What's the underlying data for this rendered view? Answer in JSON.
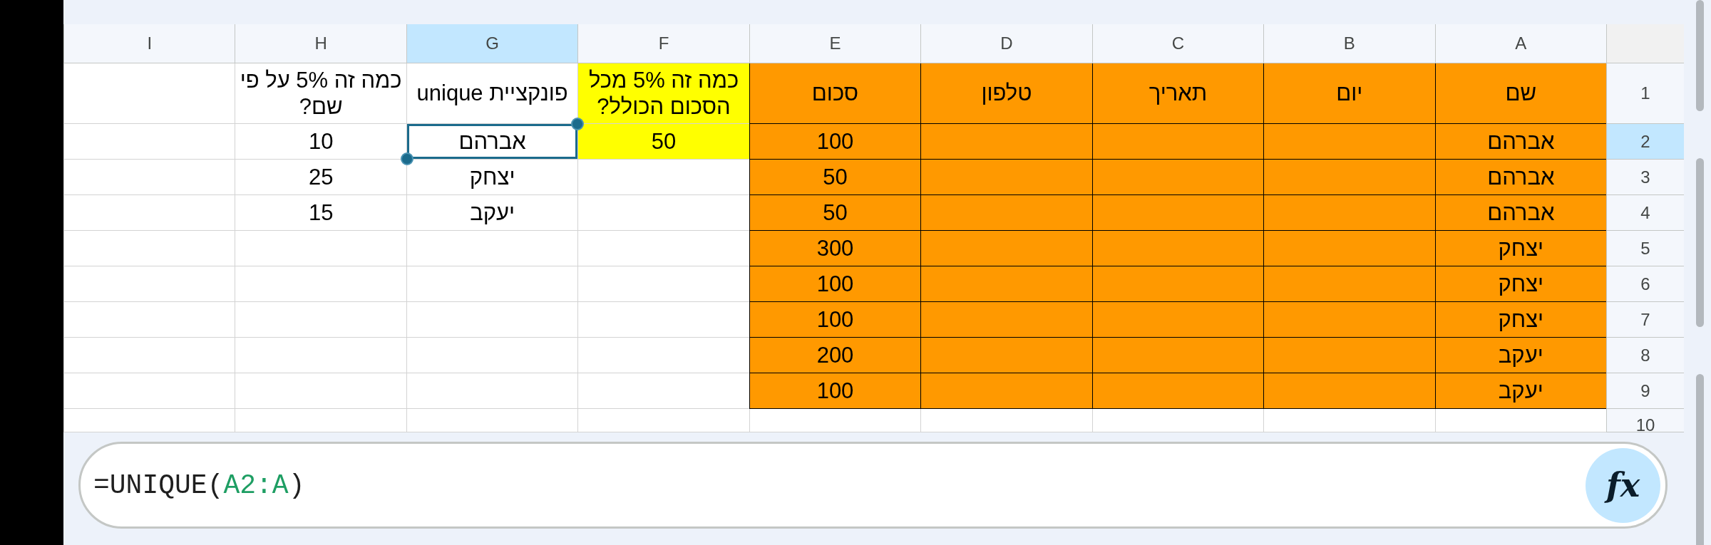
{
  "columns": [
    {
      "label": "A",
      "selected": false
    },
    {
      "label": "B",
      "selected": false
    },
    {
      "label": "C",
      "selected": false
    },
    {
      "label": "D",
      "selected": false
    },
    {
      "label": "E",
      "selected": false
    },
    {
      "label": "F",
      "selected": false
    },
    {
      "label": "G",
      "selected": true
    },
    {
      "label": "H",
      "selected": false
    },
    {
      "label": "I",
      "selected": false
    }
  ],
  "rows": [
    {
      "number": "1",
      "selected": false,
      "cells": [
        {
          "text": "שם",
          "color": "#ff9900",
          "bordered": true,
          "selected": false
        },
        {
          "text": "יום",
          "color": "#ff9900",
          "bordered": true,
          "selected": false
        },
        {
          "text": "תאריך",
          "color": "#ff9900",
          "bordered": true,
          "selected": false
        },
        {
          "text": "טלפון",
          "color": "#ff9900",
          "bordered": true,
          "selected": false
        },
        {
          "text": "סכום",
          "color": "#ff9900",
          "bordered": true,
          "selected": false
        },
        {
          "text": "כמה זה 5% מכל הסכום הכולל?",
          "color": "#ffff00",
          "selected": false
        },
        {
          "text": "פונקציית unique",
          "selected": false
        },
        {
          "text": "כמה זה 5% על פי שם?",
          "selected": false
        },
        {
          "selected": false
        }
      ]
    },
    {
      "number": "2",
      "selected": true,
      "cells": [
        {
          "text": "אברהם",
          "color": "#ff9900",
          "bordered": true,
          "selected": false
        },
        {
          "color": "#ff9900",
          "bordered": true,
          "selected": false
        },
        {
          "color": "#ff9900",
          "bordered": true,
          "selected": false
        },
        {
          "color": "#ff9900",
          "bordered": true,
          "selected": false
        },
        {
          "text": "100",
          "color": "#ff9900",
          "bordered": true,
          "selected": false
        },
        {
          "text": "50",
          "color": "#ffff00",
          "selected": false
        },
        {
          "text": "אברהם",
          "selected": true
        },
        {
          "text": "10",
          "selected": false
        },
        {
          "selected": false
        }
      ]
    },
    {
      "number": "3",
      "selected": false,
      "cells": [
        {
          "text": "אברהם",
          "color": "#ff9900",
          "bordered": true,
          "selected": false
        },
        {
          "color": "#ff9900",
          "bordered": true,
          "selected": false
        },
        {
          "color": "#ff9900",
          "bordered": true,
          "selected": false
        },
        {
          "color": "#ff9900",
          "bordered": true,
          "selected": false
        },
        {
          "text": "50",
          "color": "#ff9900",
          "bordered": true,
          "selected": false
        },
        {
          "selected": false
        },
        {
          "text": "יצחק",
          "selected": false
        },
        {
          "text": "25",
          "selected": false
        },
        {
          "selected": false
        }
      ]
    },
    {
      "number": "4",
      "selected": false,
      "cells": [
        {
          "text": "אברהם",
          "color": "#ff9900",
          "bordered": true,
          "selected": false
        },
        {
          "color": "#ff9900",
          "bordered": true,
          "selected": false
        },
        {
          "color": "#ff9900",
          "bordered": true,
          "selected": false
        },
        {
          "color": "#ff9900",
          "bordered": true,
          "selected": false
        },
        {
          "text": "50",
          "color": "#ff9900",
          "bordered": true,
          "selected": false
        },
        {
          "selected": false
        },
        {
          "text": "יעקב",
          "selected": false
        },
        {
          "text": "15",
          "selected": false
        },
        {
          "selected": false
        }
      ]
    },
    {
      "number": "5",
      "selected": false,
      "cells": [
        {
          "text": "יצחק",
          "color": "#ff9900",
          "bordered": true,
          "selected": false
        },
        {
          "color": "#ff9900",
          "bordered": true,
          "selected": false
        },
        {
          "color": "#ff9900",
          "bordered": true,
          "selected": false
        },
        {
          "color": "#ff9900",
          "bordered": true,
          "selected": false
        },
        {
          "text": "300",
          "color": "#ff9900",
          "bordered": true,
          "selected": false
        },
        {
          "selected": false
        },
        {
          "selected": false
        },
        {
          "selected": false
        },
        {
          "selected": false
        }
      ]
    },
    {
      "number": "6",
      "selected": false,
      "cells": [
        {
          "text": "יצחק",
          "color": "#ff9900",
          "bordered": true,
          "selected": false
        },
        {
          "color": "#ff9900",
          "bordered": true,
          "selected": false
        },
        {
          "color": "#ff9900",
          "bordered": true,
          "selected": false
        },
        {
          "color": "#ff9900",
          "bordered": true,
          "selected": false
        },
        {
          "text": "100",
          "color": "#ff9900",
          "bordered": true,
          "selected": false
        },
        {
          "selected": false
        },
        {
          "selected": false
        },
        {
          "selected": false
        },
        {
          "selected": false
        }
      ]
    },
    {
      "number": "7",
      "selected": false,
      "cells": [
        {
          "text": "יצחק",
          "color": "#ff9900",
          "bordered": true,
          "selected": false
        },
        {
          "color": "#ff9900",
          "bordered": true,
          "selected": false
        },
        {
          "color": "#ff9900",
          "bordered": true,
          "selected": false
        },
        {
          "color": "#ff9900",
          "bordered": true,
          "selected": false
        },
        {
          "text": "100",
          "color": "#ff9900",
          "bordered": true,
          "selected": false
        },
        {
          "selected": false
        },
        {
          "selected": false
        },
        {
          "selected": false
        },
        {
          "selected": false
        }
      ]
    },
    {
      "number": "8",
      "selected": false,
      "cells": [
        {
          "text": "יעקב",
          "color": "#ff9900",
          "bordered": true,
          "selected": false
        },
        {
          "color": "#ff9900",
          "bordered": true,
          "selected": false
        },
        {
          "color": "#ff9900",
          "bordered": true,
          "selected": false
        },
        {
          "color": "#ff9900",
          "bordered": true,
          "selected": false
        },
        {
          "text": "200",
          "color": "#ff9900",
          "bordered": true,
          "selected": false
        },
        {
          "selected": false
        },
        {
          "selected": false
        },
        {
          "selected": false
        },
        {
          "selected": false
        }
      ]
    },
    {
      "number": "9",
      "selected": false,
      "cells": [
        {
          "text": "יעקב",
          "color": "#ff9900",
          "bordered": true,
          "selected": false
        },
        {
          "color": "#ff9900",
          "bordered": true,
          "selected": false
        },
        {
          "color": "#ff9900",
          "bordered": true,
          "selected": false
        },
        {
          "color": "#ff9900",
          "bordered": true,
          "selected": false
        },
        {
          "text": "100",
          "color": "#ff9900",
          "bordered": true,
          "selected": false
        },
        {
          "selected": false
        },
        {
          "selected": false
        },
        {
          "selected": false
        },
        {
          "selected": false
        }
      ]
    },
    {
      "number": "10",
      "selected": false,
      "cells": [
        {
          "selected": false
        },
        {
          "selected": false
        },
        {
          "selected": false
        },
        {
          "selected": false
        },
        {
          "selected": false
        },
        {
          "selected": false
        },
        {
          "selected": false
        },
        {
          "selected": false
        },
        {
          "selected": false
        }
      ]
    }
  ],
  "formula_bar": {
    "formula": {
      "prefix": "=UNIQUE(",
      "range": "A2:A",
      "suffix": ")"
    },
    "button": "fx"
  }
}
